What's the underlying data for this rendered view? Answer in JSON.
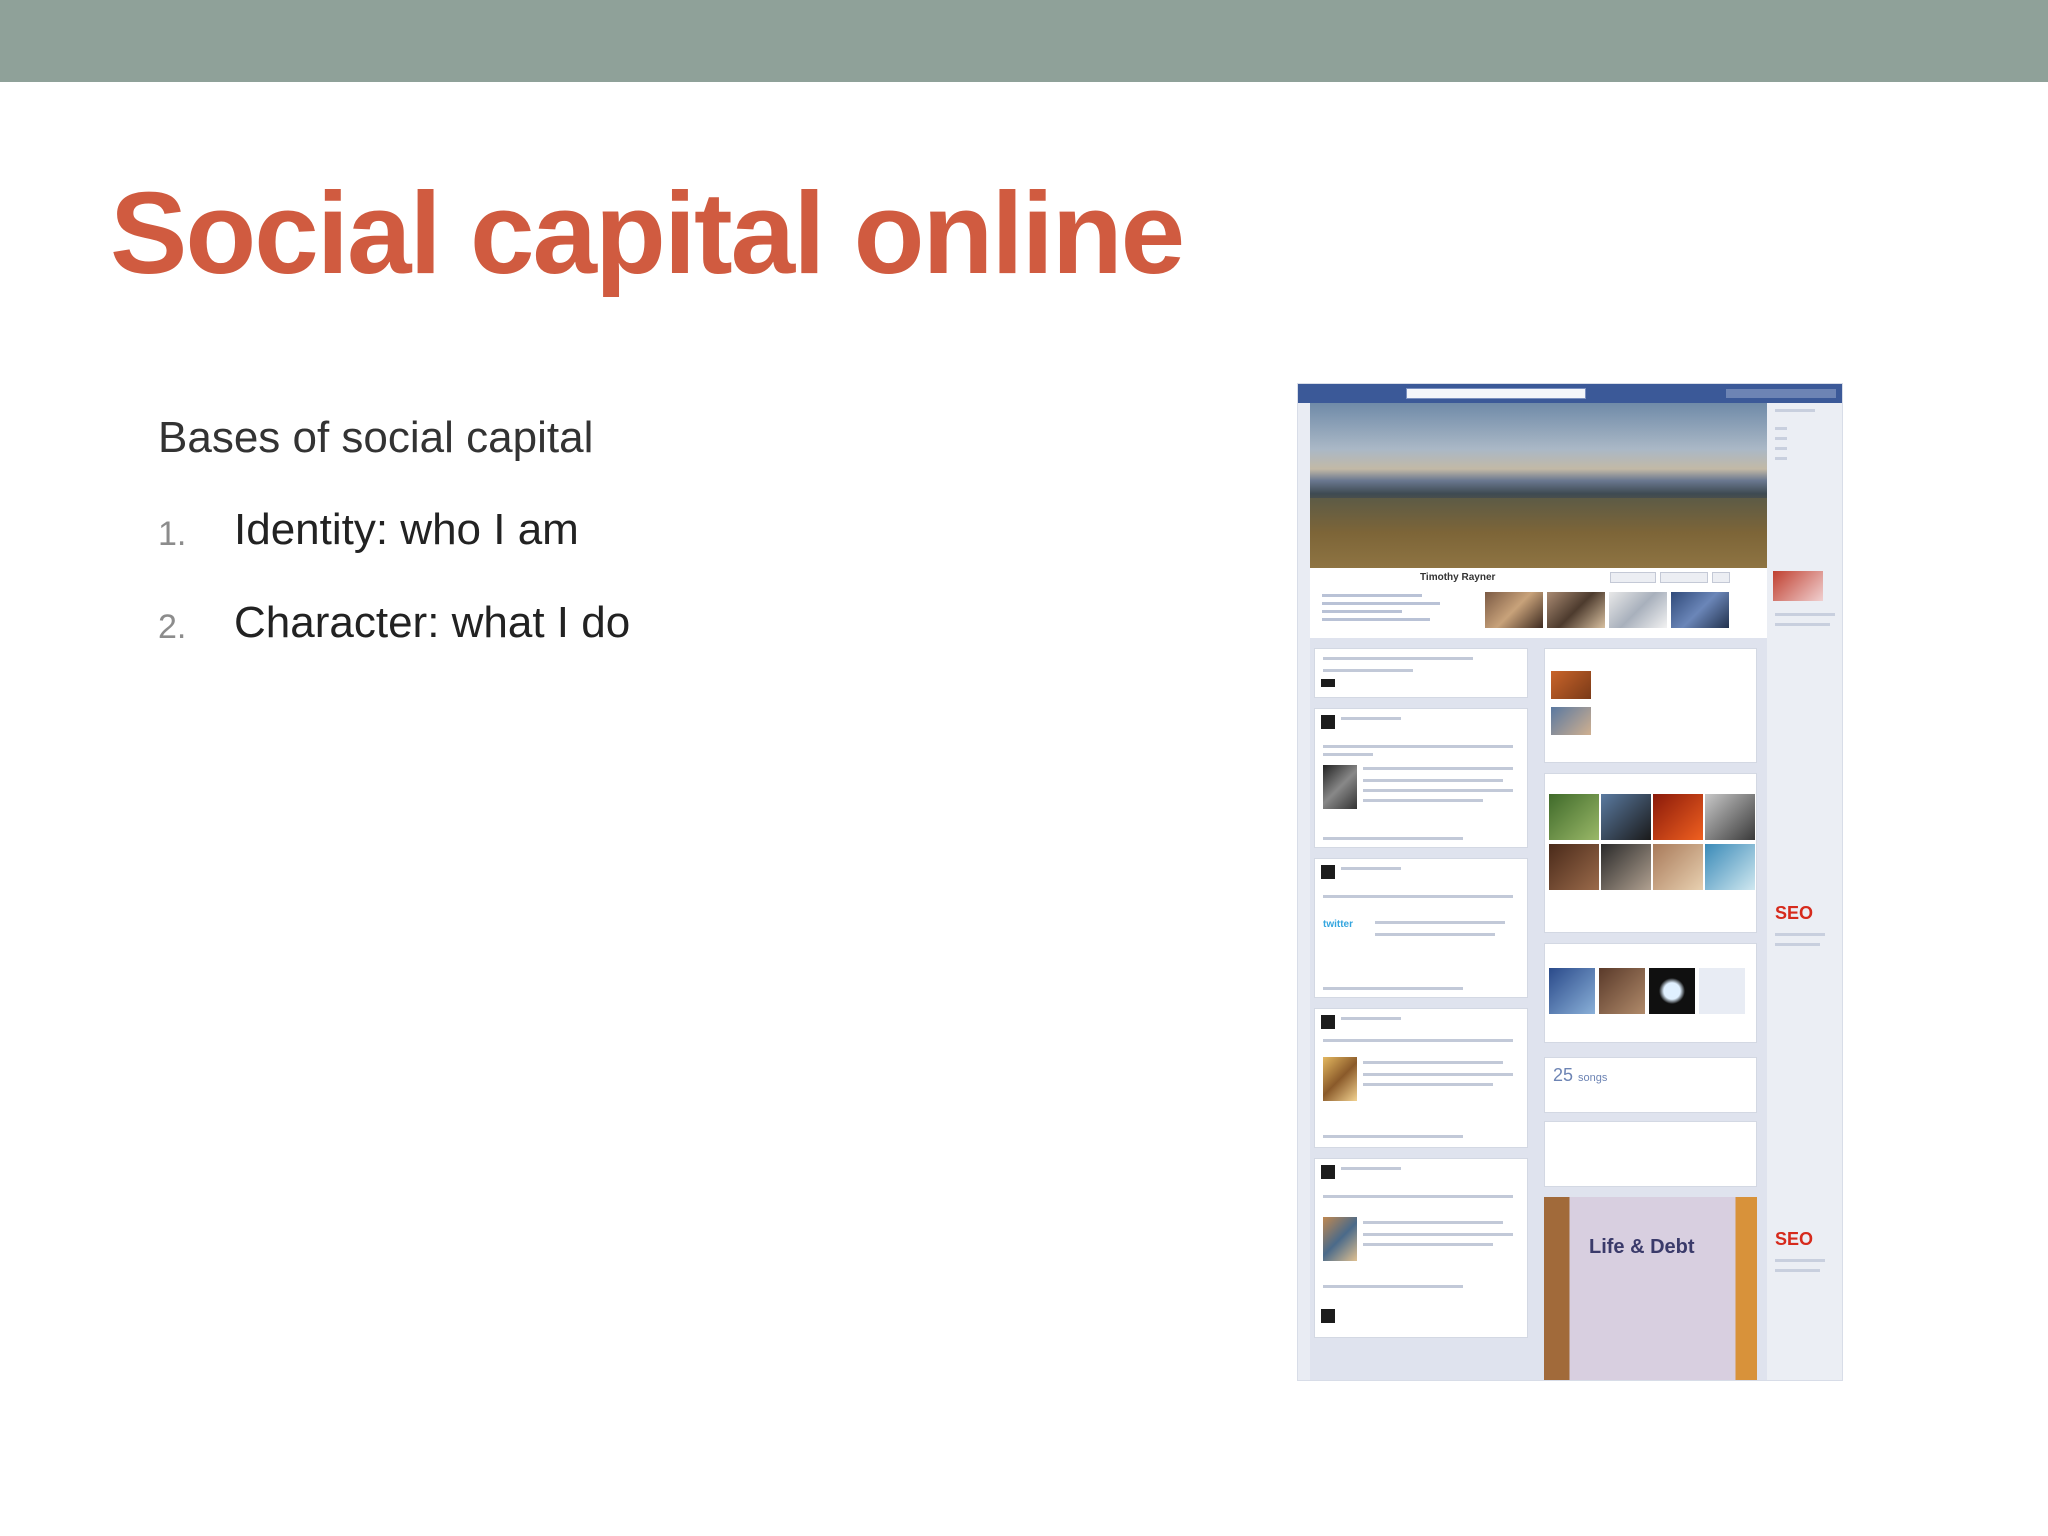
{
  "slide": {
    "title": "Social capital online",
    "heading": "Bases of social capital",
    "items": [
      {
        "number": "1.",
        "text": "Identity: who I am"
      },
      {
        "number": "2.",
        "text": "Character: what I do"
      }
    ]
  },
  "screenshot": {
    "profile_name": "Timothy Rayner",
    "songs_count": "25",
    "songs_label": "songs",
    "book_title": "Life & Debt",
    "ad_label": "SEO",
    "twitter_label": "twitter"
  },
  "colors": {
    "top_band": "#8fa199",
    "title": "#d05b40",
    "facebook_blue": "#3b5998"
  }
}
